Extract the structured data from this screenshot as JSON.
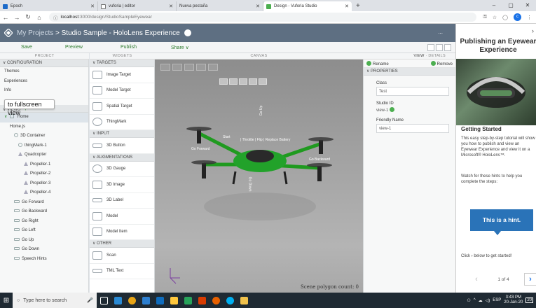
{
  "browser": {
    "tabs": [
      {
        "label": "Epoch",
        "icon": "feather-icon",
        "color": "#1b6ac9"
      },
      {
        "label": "vuforia | editor",
        "icon": "vuforia-icon",
        "color": "#6b6b6b"
      },
      {
        "label": "Nueva pestaña",
        "icon": "blank-icon",
        "color": "#dee1e6"
      },
      {
        "label": "Design - Vuforia Studio",
        "icon": "studio-icon",
        "color": "#4caf50"
      }
    ],
    "url_host": "localhost",
    "url_path": ":3000/design/StudioSampleEyewear"
  },
  "studio": {
    "breadcrumb_link": "My Projects",
    "breadcrumb_sep": ">",
    "project_title": "Studio Sample - HoloLens Experience",
    "more": "..."
  },
  "toolbar": {
    "save": "Save",
    "preview": "Preview",
    "publish": "Publish",
    "share": "Share ∨"
  },
  "columns": {
    "project": "PROJECT",
    "widgets": "WIDGETS",
    "canvas": "CANVAS",
    "view": "VIEW",
    "details": "· DETAILS"
  },
  "project": {
    "configuration": "∨ CONFIGURATION",
    "config_items": [
      "Themes",
      "Experiences",
      "Info"
    ],
    "tooltip": "to fullscreen view",
    "views": "∨ VIEWS",
    "views_plus": "+",
    "home": "Home",
    "tree": [
      {
        "label": "Home.js",
        "indent": 1,
        "icon": "none"
      },
      {
        "label": "3D Container",
        "indent": 2,
        "icon": "gear"
      },
      {
        "label": "thingMark-1",
        "indent": 3,
        "icon": "gear"
      },
      {
        "label": "Quadcopter",
        "indent": 3,
        "icon": "tri"
      },
      {
        "label": "Propeller-1",
        "indent": 4,
        "icon": "tri"
      },
      {
        "label": "Propeller-2",
        "indent": 4,
        "icon": "tri"
      },
      {
        "label": "Propeller-3",
        "indent": 4,
        "icon": "tri"
      },
      {
        "label": "Propeller-4",
        "indent": 4,
        "icon": "tri"
      },
      {
        "label": "Go Forward",
        "indent": 2,
        "icon": "btn"
      },
      {
        "label": "Go Backward",
        "indent": 2,
        "icon": "btn"
      },
      {
        "label": "Go Right",
        "indent": 2,
        "icon": "btn"
      },
      {
        "label": "Go Left",
        "indent": 2,
        "icon": "btn"
      },
      {
        "label": "Go Up",
        "indent": 2,
        "icon": "btn"
      },
      {
        "label": "Go Down",
        "indent": 2,
        "icon": "btn"
      },
      {
        "label": "Speech Hints",
        "indent": 2,
        "icon": "btn"
      }
    ]
  },
  "widgets": {
    "targets_header": "∨ TARGETS",
    "targets": [
      "Image Target",
      "Model Target",
      "Spatial Target",
      "ThingMark"
    ],
    "input_header": "∨ INPUT",
    "input": [
      "3D Button"
    ],
    "aug_header": "∨ AUGMENTATIONS",
    "augmentations": [
      "3D Gauge",
      "3D Image",
      "3D Label",
      "Model",
      "Model Item"
    ],
    "other_header": "∨ OTHER",
    "other": [
      "Scan",
      "TML Text"
    ]
  },
  "canvas": {
    "labels": {
      "go_up": "Go Up",
      "start": "Start",
      "menu": "| Throttle | Flip | Replace Battery",
      "go_forward": "Go Forward",
      "go_backward": "Go Backward",
      "go_down": "Go Down"
    },
    "scene_polygon_count": "Scene polygon count: 0"
  },
  "details": {
    "rename": "Rename",
    "remove": "Remove",
    "properties": "∨ PROPERTIES",
    "class_label": "Class",
    "class_value": "Test",
    "studio_id_label": "Studio ID",
    "studio_id_value": "view-1",
    "friendly_label": "Friendly Name",
    "friendly_value": "view-1"
  },
  "help": {
    "title": "Publishing an Eyewear Experience",
    "getting_started": "Getting Started",
    "para1": "This easy step-by-step tutorial will show you how to publish and view an Eyewear Experience and view it on a Microsoft® HoloLens™.",
    "para2": "Watch for these hints to help you complete the steps:",
    "hint": "This is a hint.",
    "click_text": "Click › below to get started!",
    "page": "1 of 4"
  },
  "taskbar": {
    "search_placeholder": "Type here to search",
    "lang": "ESP",
    "time": "3:43 PM",
    "date": "20-Jan-20",
    "notifications": "20"
  }
}
